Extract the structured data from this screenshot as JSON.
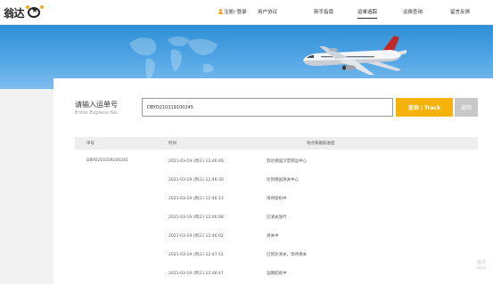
{
  "header": {
    "logo_text": "翁达",
    "nav": {
      "login": "注册/ 登录",
      "agreement": "用户协议",
      "guide": "新手指南",
      "tracking": "运单追踪",
      "rates": "运费查询",
      "feedback": "留言反馈"
    },
    "active_item": "运单追踪",
    "accent_color": "#f5a623"
  },
  "search": {
    "title": "请输入运单号",
    "subtitle": "Enter Express No.",
    "value": "DBYO210319100245",
    "track_label": "查询 / Track",
    "back_label": "返回",
    "track_color": "#f5b20a"
  },
  "table": {
    "headers": [
      "单号",
      "时间",
      "地点和跟踪进度"
    ],
    "rows": [
      {
        "number": "DBYO210319100245",
        "time": "2021-03-19 (周三) 12:46:46",
        "status": "到达德国汉堡转运中心"
      },
      {
        "number": "",
        "time": "2021-03-19 (周三) 12:46:30",
        "status": "达到德国清关中心"
      },
      {
        "number": "",
        "time": "2021-03-19 (周三) 12:46:13",
        "status": "等待提机中"
      },
      {
        "number": "",
        "time": "2021-03-19 (周三) 12:46:08",
        "status": "已清关放行"
      },
      {
        "number": "",
        "time": "2021-03-19 (周三) 12:46:02",
        "status": "清关中"
      },
      {
        "number": "",
        "time": "2021-03-19 (周三) 12:47:51",
        "status": "已到达清关，等待清关"
      },
      {
        "number": "",
        "time": "2021-03-19 (周三) 12:46:47",
        "status": "运输航班中"
      }
    ]
  },
  "watermark": {
    "line1": "激活",
    "line2": "转到设"
  }
}
